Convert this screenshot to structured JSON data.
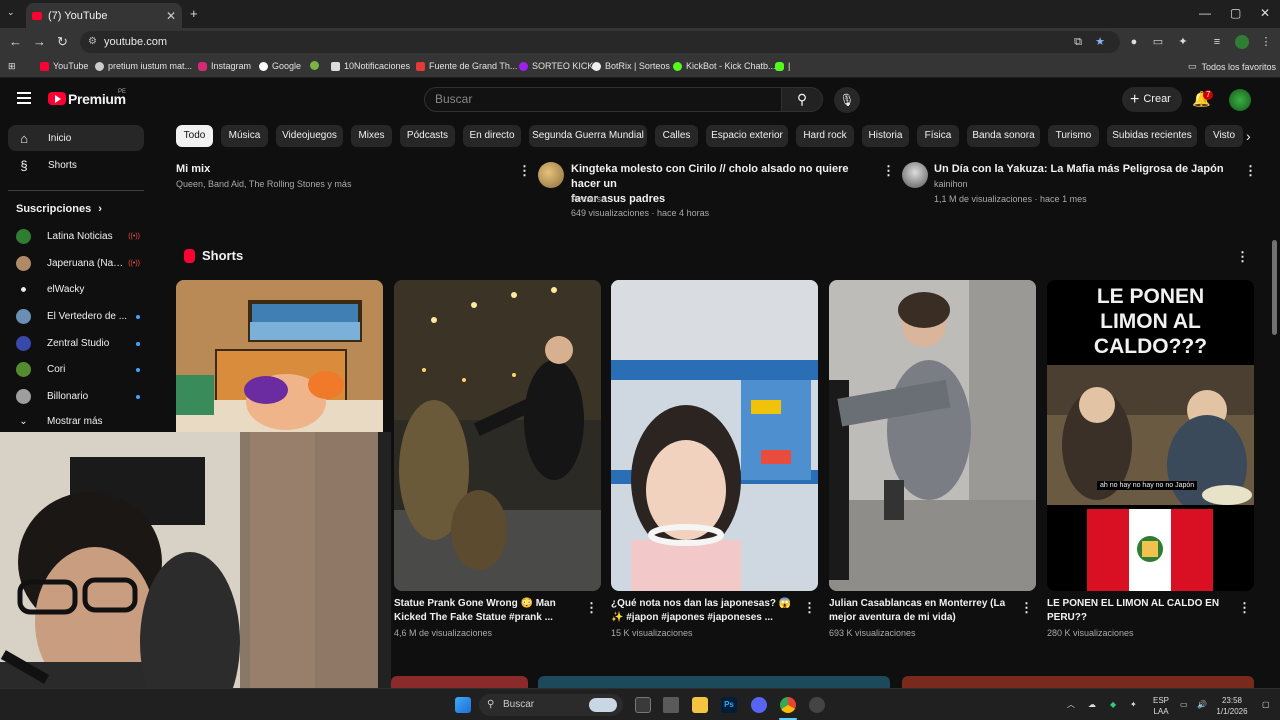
{
  "browser": {
    "tab_title": "(7) YouTube",
    "new_tab": "+",
    "url": "youtube.com",
    "bookmarks": [
      {
        "label": "YouTube",
        "color": "#ff0033"
      },
      {
        "label": "pretium iustum mat...",
        "color": "#cccccc"
      },
      {
        "label": "Instagram",
        "color": "#d62976"
      },
      {
        "label": "Google",
        "color": "#4285f4"
      },
      {
        "label": "",
        "color": "#7cb342"
      },
      {
        "label": "10Notificaciones",
        "color": "#dddddd"
      },
      {
        "label": "Fuente de Grand Th...",
        "color": "#e53935"
      },
      {
        "label": "SORTEO KICK",
        "color": "#a020f0"
      },
      {
        "label": "BotRix | Sorteos",
        "color": "#eeeeee"
      },
      {
        "label": "KickBot - Kick Chatb...",
        "color": "#53fc18"
      },
      {
        "label": "|",
        "color": "#53fc18"
      }
    ],
    "all_favorites": "Todos los favoritos"
  },
  "header": {
    "logo_text": "Premium",
    "region": "PE",
    "search_placeholder": "Buscar",
    "create_label": "Crear",
    "notifications": "7"
  },
  "sidebar": {
    "items": [
      {
        "label": "Inicio",
        "icon": "home-icon"
      },
      {
        "label": "Shorts",
        "icon": "shorts-icon"
      }
    ],
    "subscriptions_title": "Suscripciones",
    "subscriptions": [
      {
        "label": "Latina Noticias",
        "status": "live",
        "color": "#2e7d32"
      },
      {
        "label": "Japeruana (Nam...",
        "status": "live",
        "color": "#b08968"
      },
      {
        "label": "elWacky",
        "status": "",
        "color": "#eeeeee"
      },
      {
        "label": "El Vertedero de ...",
        "status": "new",
        "color": "#6b8fb3"
      },
      {
        "label": "Zentral Studio",
        "status": "new",
        "color": "#3949ab"
      },
      {
        "label": "Cori",
        "status": "new",
        "color": "#558b2f"
      },
      {
        "label": "Billonario",
        "status": "new",
        "color": "#9e9e9e"
      }
    ],
    "show_more": "Mostrar más"
  },
  "chips": [
    "Todo",
    "Música",
    "Videojuegos",
    "Mixes",
    "Pódcasts",
    "En directo",
    "Segunda Guerra Mundial",
    "Calles",
    "Espacio exterior",
    "Hard rock",
    "Historia",
    "Física",
    "Banda sonora",
    "Turismo",
    "Subidas recientes",
    "Visto"
  ],
  "feed": [
    {
      "title": "Mi mix",
      "meta1": "Queen, Band Aid, The Rolling Stones y más"
    },
    {
      "title_line1": "Kingteka molesto con Cirilo // cholo alsado no quiere hacer un",
      "title_line2": "favor asus padres",
      "channel": "Pecausa",
      "stats": "649 visualizaciones · hace 4 horas"
    },
    {
      "title": "Un Día con la Yakuza: La Mafia más Peligrosa de Japón",
      "channel": "kainihon",
      "stats": "1,1 M de visualizaciones · hace 1 mes"
    }
  ],
  "shorts": {
    "section_title": "Shorts",
    "items": [
      {
        "title_line1": "",
        "title_line2": "",
        "views": ""
      },
      {
        "title_line1": "Statue Prank Gone Wrong 😳 Man",
        "title_line2": "Kicked The Fake Statue #prank ...",
        "views": "4,6 M de visualizaciones"
      },
      {
        "title_line1": "¿Qué nota nos dan las japonesas? 😱",
        "title_line2": "✨ #japon #japones #japoneses ...",
        "views": "15 K visualizaciones"
      },
      {
        "title_line1": "Julian Casablancas en Monterrey (La",
        "title_line2": "mejor aventura de mi vida)",
        "views": "693 K visualizaciones"
      },
      {
        "title_line1": "LE PONEN EL LIMON AL CALDO EN",
        "title_line2": "PERU??",
        "views": "280 K visualizaciones"
      }
    ],
    "thumb5_caption": "LE PONEN LIMON AL CALDO???",
    "thumb5_subtitle": "ah no hay no hay no no Japón"
  },
  "taskbar": {
    "search": "Buscar",
    "lang1": "ESP",
    "lang2": "LAA",
    "time": "23:58",
    "date": "1/1/2026"
  }
}
